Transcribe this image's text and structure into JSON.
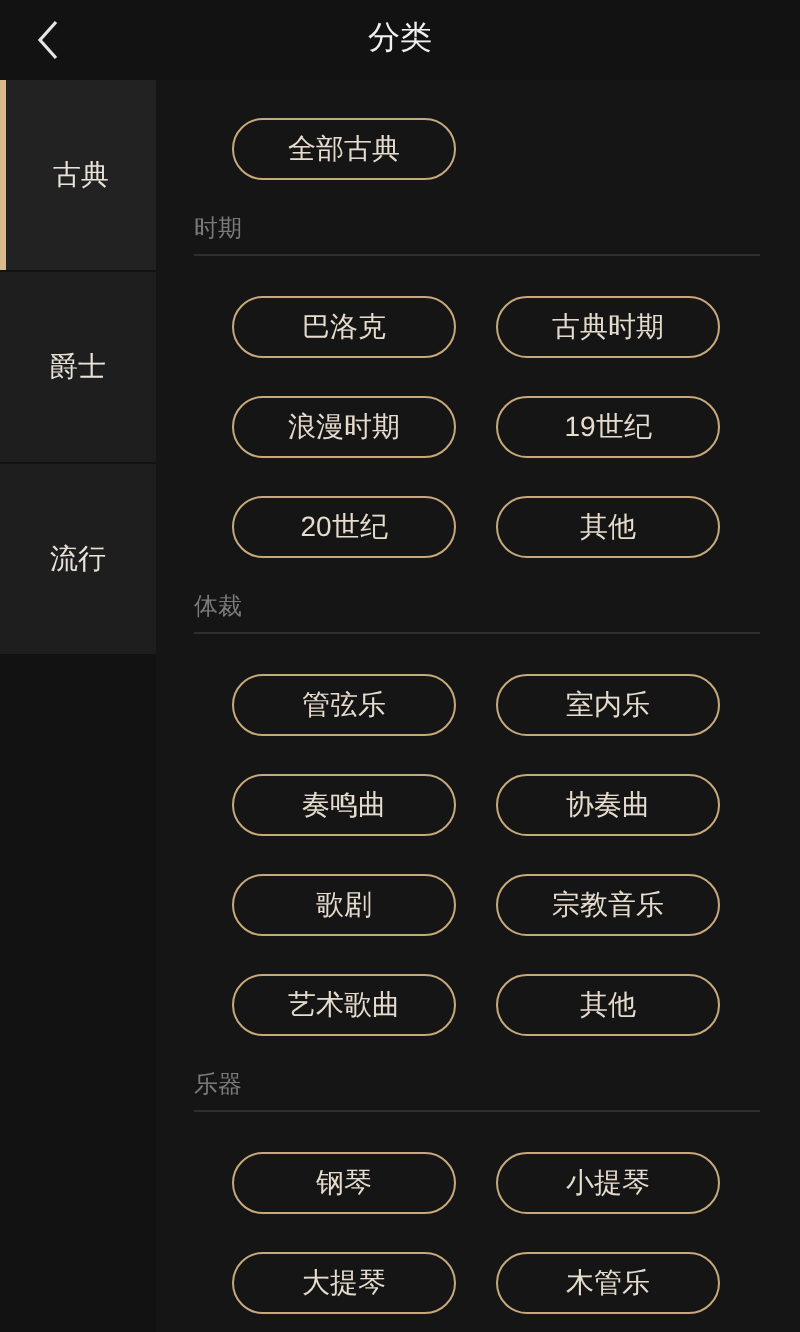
{
  "header": {
    "title": "分类"
  },
  "sidebar": {
    "items": [
      {
        "label": "古典",
        "selected": true
      },
      {
        "label": "爵士",
        "selected": false
      },
      {
        "label": "流行",
        "selected": false
      }
    ]
  },
  "all_button": "全部古典",
  "sections": [
    {
      "title": "时期",
      "items": [
        "巴洛克",
        "古典时期",
        "浪漫时期",
        "19世纪",
        "20世纪",
        "其他"
      ]
    },
    {
      "title": "体裁",
      "items": [
        "管弦乐",
        "室内乐",
        "奏鸣曲",
        "协奏曲",
        "歌剧",
        "宗教音乐",
        "艺术歌曲",
        "其他"
      ]
    },
    {
      "title": "乐器",
      "items": [
        "钢琴",
        "小提琴",
        "大提琴",
        "木管乐"
      ]
    }
  ]
}
